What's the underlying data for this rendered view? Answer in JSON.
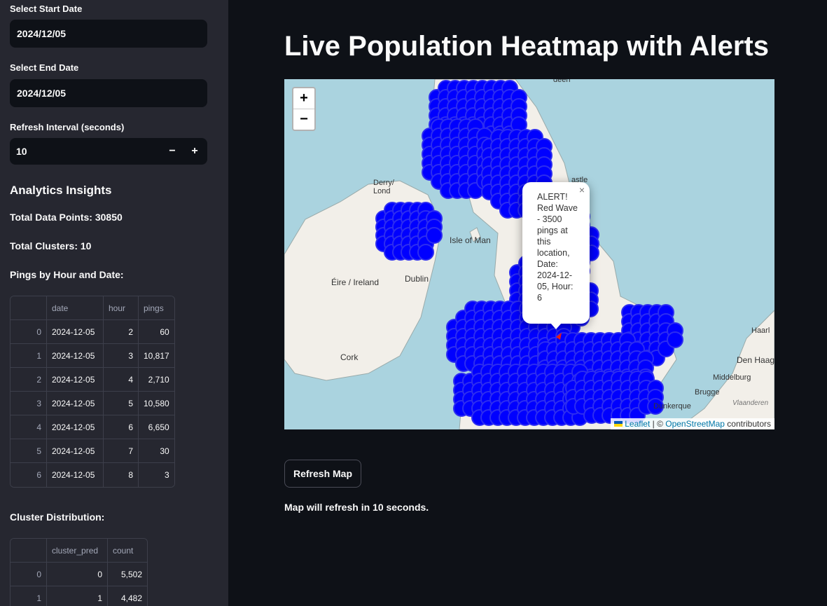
{
  "sidebar": {
    "start_date_label": "Select Start Date",
    "start_date_value": "2024/12/05",
    "end_date_label": "Select End Date",
    "end_date_value": "2024/12/05",
    "refresh_label": "Refresh Interval (seconds)",
    "refresh_value": "10",
    "minus": "−",
    "plus": "+",
    "analytics_title": "Analytics Insights",
    "total_points": "Total Data Points: 30850",
    "total_clusters": "Total Clusters: 10",
    "pings_title": "Pings by Hour and Date:",
    "cluster_title": "Cluster Distribution:"
  },
  "pings_table": {
    "columns": [
      "",
      "date",
      "hour",
      "pings"
    ],
    "rows": [
      [
        "0",
        "2024-12-05",
        "2",
        "60"
      ],
      [
        "1",
        "2024-12-05",
        "3",
        "10,817"
      ],
      [
        "2",
        "2024-12-05",
        "4",
        "2,710"
      ],
      [
        "3",
        "2024-12-05",
        "5",
        "10,580"
      ],
      [
        "4",
        "2024-12-05",
        "6",
        "6,650"
      ],
      [
        "5",
        "2024-12-05",
        "7",
        "30"
      ],
      [
        "6",
        "2024-12-05",
        "8",
        "3"
      ]
    ]
  },
  "cluster_table": {
    "columns": [
      "",
      "cluster_pred",
      "count"
    ],
    "rows": [
      [
        "0",
        "0",
        "5,502"
      ],
      [
        "1",
        "1",
        "4,482"
      ]
    ]
  },
  "main": {
    "title": "Live Population Heatmap with Alerts",
    "refresh_button": "Refresh Map",
    "status": "Map will refresh in 10 seconds."
  },
  "map": {
    "zoom_in": "+",
    "zoom_out": "−",
    "popup_text": "ALERT! Red Wave - 3500 pings at this location, Date: 2024-12-05, Hour: 6",
    "popup_close": "×",
    "attribution_leaflet": "Leaflet",
    "attribution_sep": " | © ",
    "attribution_osm": "OpenStreetMap",
    "attribution_tail": " contributors",
    "labels": {
      "derry": "Derry/\nLond",
      "isle_of_man": "Isle of Man",
      "eire": "Éire / Ireland",
      "dublin": "Dublin",
      "cork": "Cork",
      "haarlem": "Haarl",
      "den_haag": "Den Haag",
      "middelburg": "Middelburg",
      "brugge": "Brugge",
      "dunkerque": "Dunkerque",
      "vlaanderen": "Vlaanderen",
      "castle": "astle",
      "aberdeen": "deen"
    },
    "colors": {
      "sea": "#aad3df",
      "land": "#f2efe9",
      "cluster": "#0000ff",
      "cluster_stroke": "#2d2df0",
      "alert": "#e31a1c"
    }
  }
}
